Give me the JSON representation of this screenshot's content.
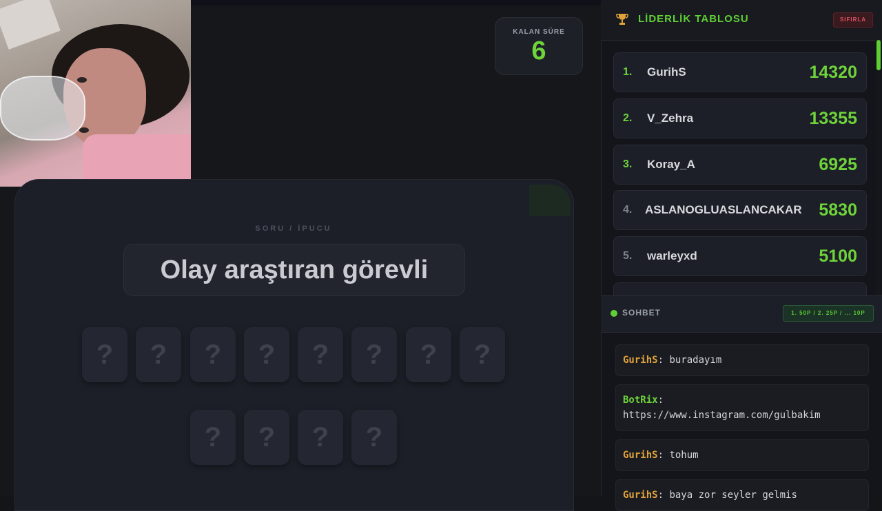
{
  "timer": {
    "label": "KALAN SÜRE",
    "value": "6"
  },
  "game": {
    "hint_label": "SORU / İPUCU",
    "hint_text": "Olay araştıran görevli",
    "tile_glyph": "?"
  },
  "leaderboard": {
    "title": "LİDERLİK TABLOSU",
    "reset_label": "SIFIRLA",
    "rows": [
      {
        "rank": "1.",
        "name": "GurihS",
        "score": "14320"
      },
      {
        "rank": "2.",
        "name": "V_Zehra",
        "score": "13355"
      },
      {
        "rank": "3.",
        "name": "Koray_A",
        "score": "6925"
      },
      {
        "rank": "4.",
        "name": "ASLANOGLUASLANCAKAR",
        "score": "5830"
      },
      {
        "rank": "5.",
        "name": "warleyxd",
        "score": "5100"
      }
    ]
  },
  "chat": {
    "title": "SOHBET",
    "rules": "1. 50P / 2. 25P / ... 10P",
    "messages": [
      {
        "user": "GurihS",
        "sep": ":",
        "text": "buradayım",
        "user_color": "#e0a33a"
      },
      {
        "user": "BotRix",
        "sep": ":",
        "text": "https://www.instagram.com/gulbakim",
        "user_color": "#6fd33a"
      },
      {
        "user": "GurihS",
        "sep": ":",
        "text": "tohum",
        "user_color": "#e0a33a"
      },
      {
        "user": "GurihS",
        "sep": ":",
        "text": "baya zor seyler gelmis",
        "user_color": "#e0a33a"
      }
    ]
  },
  "colors": {
    "accent": "#6fd33a",
    "rank_gold": "#6fd33a",
    "rank_muted": "#7d828d"
  }
}
